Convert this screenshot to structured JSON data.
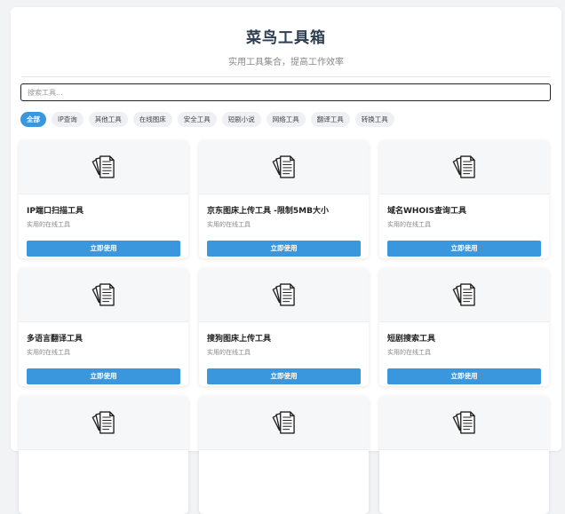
{
  "header": {
    "title": "菜鸟工具箱",
    "subtitle": "实用工具集合，提高工作效率"
  },
  "search": {
    "placeholder": "搜索工具..."
  },
  "categories": [
    {
      "label": "全部",
      "active": true
    },
    {
      "label": "IP查询"
    },
    {
      "label": "其他工具"
    },
    {
      "label": "在线图床"
    },
    {
      "label": "安全工具"
    },
    {
      "label": "短剧小说"
    },
    {
      "label": "网络工具"
    },
    {
      "label": "翻译工具"
    },
    {
      "label": "转换工具"
    }
  ],
  "tools": [
    {
      "name": "IP端口扫描工具",
      "desc": "实用的在线工具",
      "button": "立即使用",
      "icon": "document-icon"
    },
    {
      "name": "京东图床上传工具 -限制5MB大小",
      "desc": "实用的在线工具",
      "button": "立即使用",
      "icon": "document-icon"
    },
    {
      "name": "域名WHOIS查询工具",
      "desc": "实用的在线工具",
      "button": "立即使用",
      "icon": "document-icon"
    },
    {
      "name": "多语言翻译工具",
      "desc": "实用的在线工具",
      "button": "立即使用",
      "icon": "document-icon"
    },
    {
      "name": "搜狗图床上传工具",
      "desc": "实用的在线工具",
      "button": "立即使用",
      "icon": "document-icon"
    },
    {
      "name": "短剧搜索工具",
      "desc": "实用的在线工具",
      "button": "立即使用",
      "icon": "document-icon"
    },
    {
      "name": "",
      "desc": "",
      "button": "",
      "icon": "document-icon"
    },
    {
      "name": "",
      "desc": "",
      "button": "",
      "icon": "document-icon"
    },
    {
      "name": "",
      "desc": "",
      "button": "",
      "icon": "document-icon"
    }
  ]
}
